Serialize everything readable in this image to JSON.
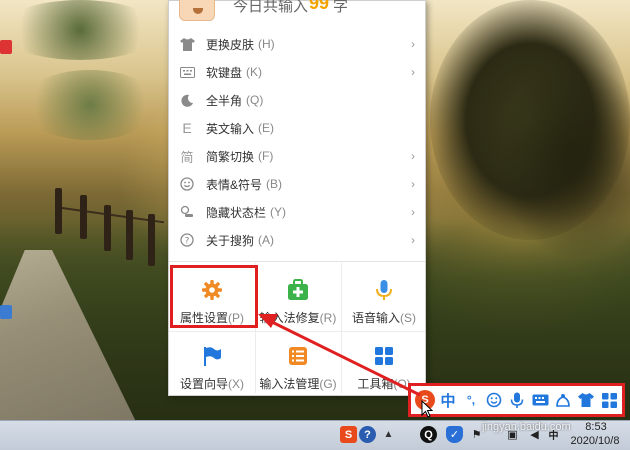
{
  "menu": {
    "header": {
      "text": "今日共输入",
      "count": "99",
      "unit": "字"
    },
    "items": [
      {
        "label": "更换皮肤",
        "shortcut": "(H)",
        "icon": "shirt-icon",
        "submenu": true
      },
      {
        "label": "软键盘",
        "shortcut": "(K)",
        "icon": "keyboard-icon",
        "submenu": true
      },
      {
        "label": "全半角",
        "shortcut": "(Q)",
        "icon": "moon-icon",
        "submenu": false
      },
      {
        "label": "英文输入",
        "shortcut": "(E)",
        "icon": "letter-e-icon",
        "submenu": false
      },
      {
        "label": "简繁切换",
        "shortcut": "(F)",
        "icon": "jian-icon",
        "submenu": true
      },
      {
        "label": "表情&符号",
        "shortcut": "(B)",
        "icon": "smiley-icon",
        "submenu": true
      },
      {
        "label": "隐藏状态栏",
        "shortcut": "(Y)",
        "icon": "hide-statusbar-icon",
        "submenu": true
      },
      {
        "label": "关于搜狗",
        "shortcut": "(A)",
        "icon": "question-icon",
        "submenu": true
      }
    ],
    "tiles": [
      {
        "label": "属性设置",
        "shortcut": "(P)",
        "icon": "gear-icon"
      },
      {
        "label": "输入法修复",
        "shortcut": "(R)",
        "icon": "repair-kit-icon"
      },
      {
        "label": "语音输入",
        "shortcut": "(S)",
        "icon": "microphone-icon"
      },
      {
        "label": "设置向导",
        "shortcut": "(X)",
        "icon": "flag-icon"
      },
      {
        "label": "输入法管理",
        "shortcut": "(G)",
        "icon": "ime-manage-icon"
      },
      {
        "label": "工具箱",
        "shortcut": "(O)",
        "icon": "toolbox-icon"
      }
    ]
  },
  "imebar": {
    "items": [
      "sogou-logo-icon",
      "中",
      "°,",
      "smiley-icon",
      "microphone-icon",
      "keyboard-icon",
      "skin-icon",
      "shirt-icon",
      "grid-icon"
    ],
    "mode_label": "中",
    "punct_label": "°,"
  },
  "taskbar": {
    "time": "8:53",
    "date": "2020/10/8"
  },
  "watermark": "jingyan.baidu.com",
  "colors": {
    "highlight": "#e02020",
    "accent_orange": "#f08a24",
    "accent_blue": "#2277dd",
    "accent_green": "#3bb34a"
  }
}
